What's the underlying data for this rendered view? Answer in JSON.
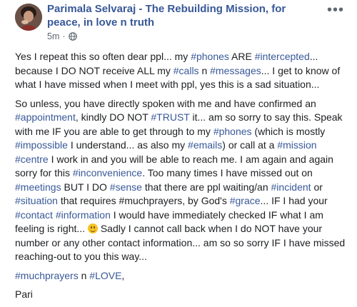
{
  "post": {
    "author": "Parimala Selvaraj - The Rebuilding Mission, for peace, in love n truth",
    "time": "5m",
    "privacy_icon": "globe-icon",
    "more_icon": "more-options-icon",
    "paragraphs": [
      [
        {
          "t": "Yes I repeat this so often dear ppl... my "
        },
        {
          "tag": "#phones"
        },
        {
          "t": " ARE "
        },
        {
          "tag": "#intercepted"
        },
        {
          "t": "... because I DO NOT receive ALL my "
        },
        {
          "tag": "#calls"
        },
        {
          "t": " n "
        },
        {
          "tag": "#messages"
        },
        {
          "t": "... I get to know of what I have missed when I meet with ppl, yes this is a sad situation..."
        }
      ],
      [
        {
          "t": "So unless, you have directly spoken with me and have confirmed an "
        },
        {
          "tag": "#appointment"
        },
        {
          "t": ", kindly DO NOT "
        },
        {
          "tag": "#TRUST"
        },
        {
          "t": " it... am so sorry to say this. Speak with me IF you are able to get through to my "
        },
        {
          "tag": "#phones"
        },
        {
          "t": " (which is mostly "
        },
        {
          "tag": "#impossible"
        },
        {
          "t": " I understand... as also my "
        },
        {
          "tag": "#emails"
        },
        {
          "t": ") or call at a "
        },
        {
          "tag": "#mission"
        },
        {
          "t": " "
        },
        {
          "tag": "#centre"
        },
        {
          "t": " I work in and you will be able to reach me. I am again and again sorry for this "
        },
        {
          "tag": "#inconvenience"
        },
        {
          "t": ". Too many times I have missed out on "
        },
        {
          "tag": "#meetings"
        },
        {
          "t": " BUT I DO "
        },
        {
          "tag": "#sense"
        },
        {
          "t": " that there are ppl waiting/an "
        },
        {
          "tag": "#incident"
        },
        {
          "t": " or "
        },
        {
          "tag": "#situation"
        },
        {
          "t": " that requires #muchprayers, by God's "
        },
        {
          "tag": "#grace"
        },
        {
          "t": "... IF I had your "
        },
        {
          "tag": "#contact"
        },
        {
          "t": " "
        },
        {
          "tag": "#information"
        },
        {
          "t": " I would have immediately checked IF what I am feeling is right... "
        },
        {
          "emoji": "smile-emoji-icon"
        },
        {
          "t": " Sadly I cannot call back when I do NOT have your number or any other contact information... am so so sorry IF I have missed reaching-out to you this way..."
        }
      ],
      [
        {
          "tag": "#muchprayers"
        },
        {
          "t": " n "
        },
        {
          "tag": "#LOVE"
        },
        {
          "t": ","
        }
      ],
      [
        {
          "t": "Pari"
        }
      ]
    ]
  }
}
